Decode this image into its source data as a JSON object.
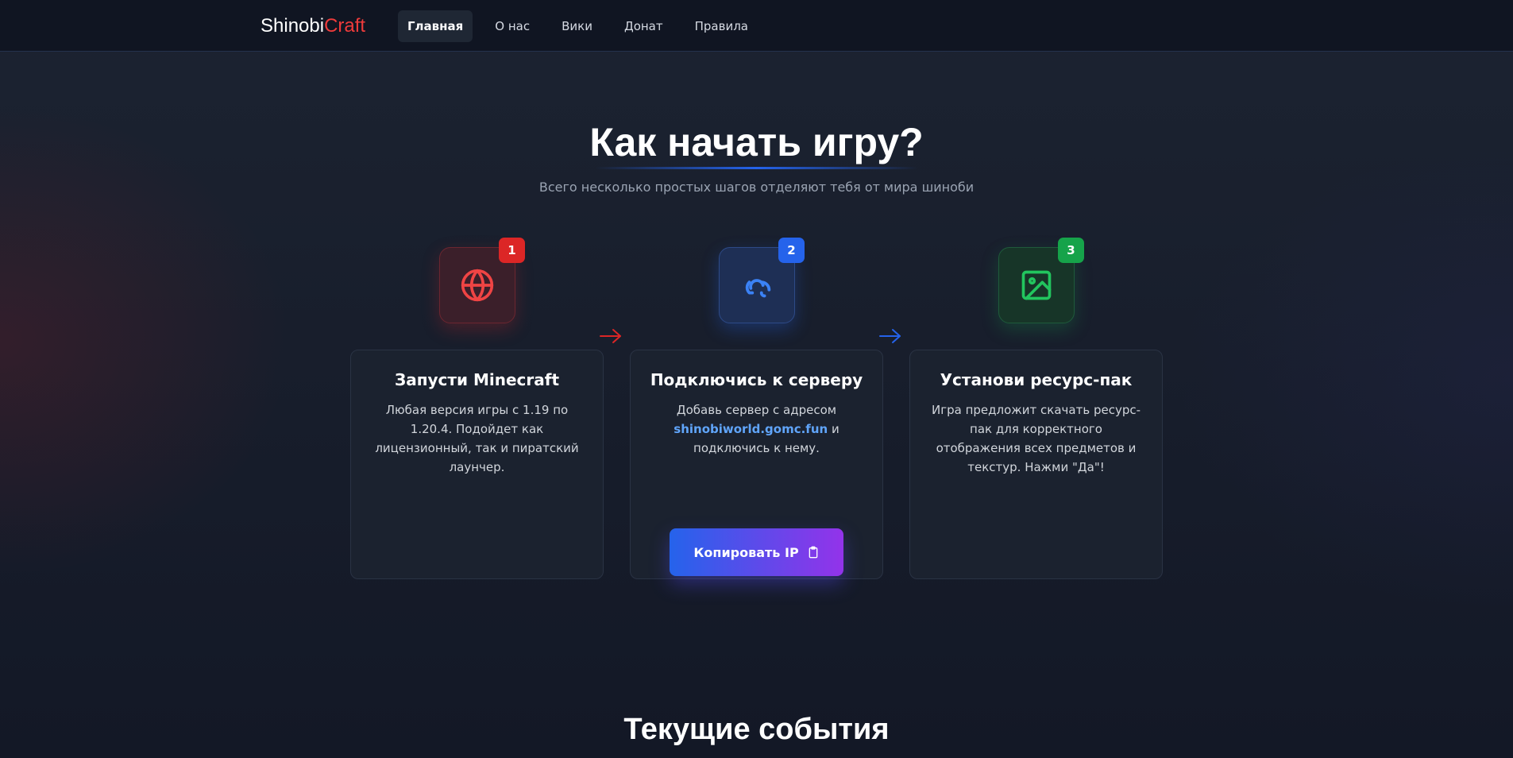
{
  "nav": {
    "logo_main": "Shinobi",
    "logo_accent": "Craft",
    "links": [
      {
        "label": "Главная",
        "active": true
      },
      {
        "label": "О нас",
        "active": false
      },
      {
        "label": "Вики",
        "active": false
      },
      {
        "label": "Донат",
        "active": false
      },
      {
        "label": "Правила",
        "active": false
      }
    ]
  },
  "hero": {
    "title": "Как начать игру?",
    "subtitle": "Всего несколько простых шагов отделяют тебя от мира шиноби"
  },
  "steps": [
    {
      "number": "1",
      "icon": "globe-icon",
      "color": "#ef4444",
      "title": "Запусти Minecraft",
      "text": "Любая версия игры с 1.19 по 1.20.4. Подойдет как лицензионный, так и пиратский лаунчер."
    },
    {
      "number": "2",
      "icon": "link-icon",
      "color": "#3b82f6",
      "title": "Подключись к серверу",
      "text_before": "Добавь сервер с адресом",
      "server_address": "shinobiworld.gomc.fun",
      "text_after": "и подключись к нему.",
      "button_label": "Копировать IP",
      "button_icon": "clipboard-icon"
    },
    {
      "number": "3",
      "icon": "image-icon",
      "color": "#22c55e",
      "title": "Установи ресурс-пак",
      "text": "Игра предложит скачать ресурс-пак для корректного отображения всех предметов и текстур. Нажми \"Да\"!"
    }
  ],
  "events": {
    "title": "Текущие события"
  }
}
